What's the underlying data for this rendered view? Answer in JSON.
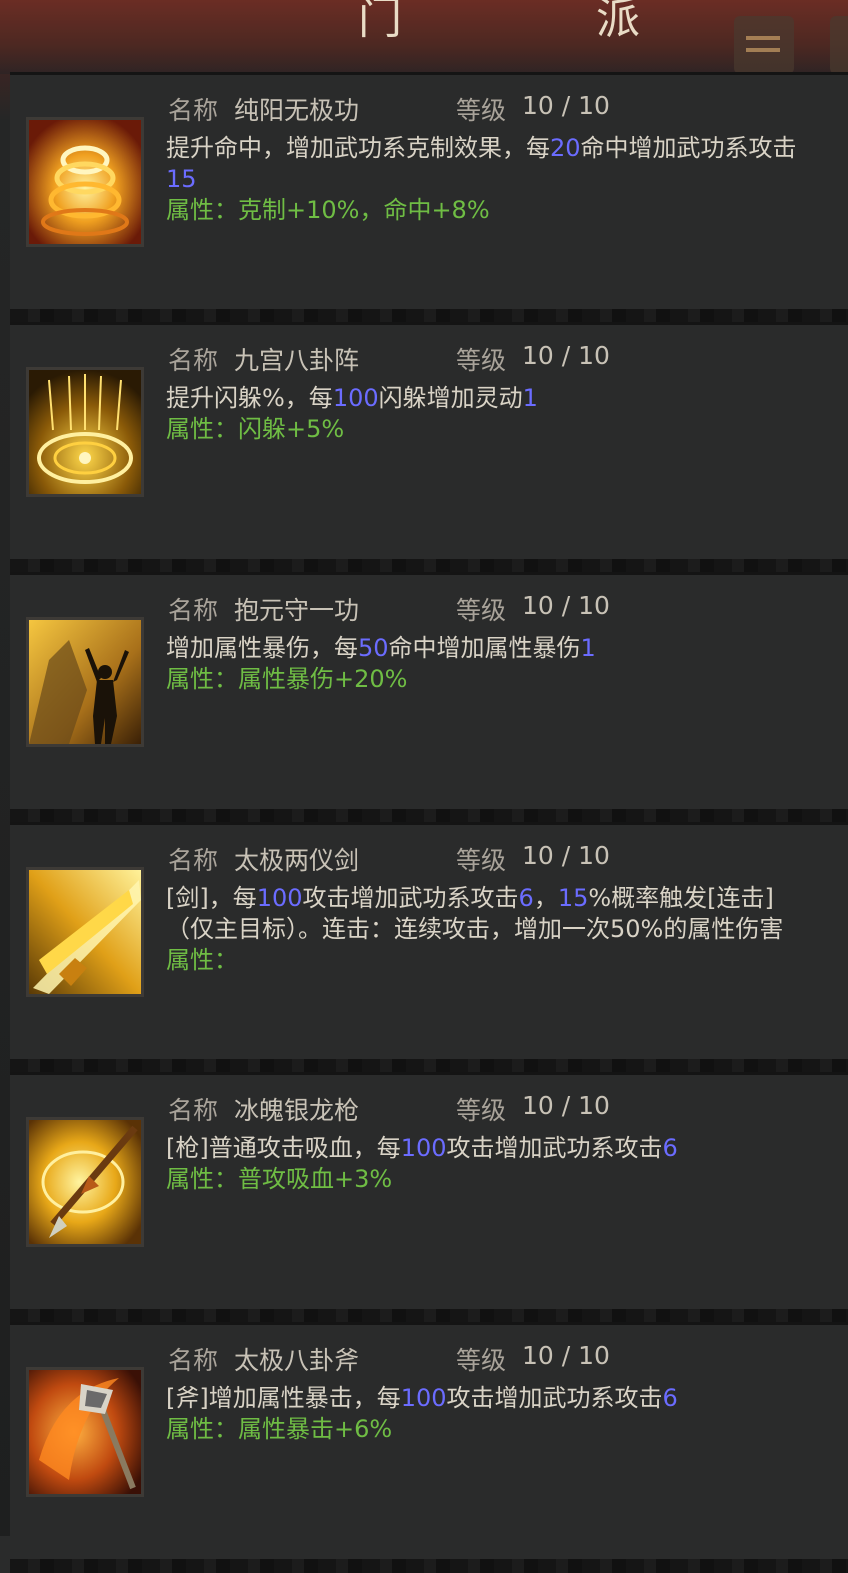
{
  "header": {
    "title": "门 派"
  },
  "labels": {
    "name": "名称",
    "level": "等级"
  },
  "skills": [
    {
      "name": "纯阳无极功",
      "level": "10 / 10",
      "icon": "golden-vortex-icon",
      "desc": [
        {
          "t": "提升命中，增加武功系克制效果，每"
        },
        {
          "t": "20",
          "h": true
        },
        {
          "t": "命中增加武功系攻击"
        },
        {
          "t": "15",
          "h": true
        }
      ],
      "attr": "属性：克制+10%，命中+8%"
    },
    {
      "name": "九宫八卦阵",
      "level": "10 / 10",
      "icon": "bagua-circle-icon",
      "desc": [
        {
          "t": "提升闪躲%，每"
        },
        {
          "t": "100",
          "h": true
        },
        {
          "t": "闪躲增加灵动"
        },
        {
          "t": "1",
          "h": true
        }
      ],
      "attr": "属性：闪躲+5%"
    },
    {
      "name": "抱元守一功",
      "level": "10 / 10",
      "icon": "meditating-figure-icon",
      "desc": [
        {
          "t": "增加属性暴伤，每"
        },
        {
          "t": "50",
          "h": true
        },
        {
          "t": "命中增加属性暴伤"
        },
        {
          "t": "1",
          "h": true
        }
      ],
      "attr": "属性：属性暴伤+20%"
    },
    {
      "name": "太极两仪剑",
      "level": "10 / 10",
      "icon": "sword-slash-icon",
      "desc": [
        {
          "t": "[剑]，每"
        },
        {
          "t": "100",
          "h": true
        },
        {
          "t": "攻击增加武功系攻击"
        },
        {
          "t": "6",
          "h": true
        },
        {
          "t": "，"
        },
        {
          "t": "15",
          "h": true
        },
        {
          "t": "%概率触发[连击]（仅主目标）。连击：连续攻击，增加一次50%的属性伤害"
        }
      ],
      "attr": "属性："
    },
    {
      "name": "冰魄银龙枪",
      "level": "10 / 10",
      "icon": "spear-thrust-icon",
      "desc": [
        {
          "t": "[枪]普通攻击吸血，每"
        },
        {
          "t": "100",
          "h": true
        },
        {
          "t": "攻击增加武功系攻击"
        },
        {
          "t": "6",
          "h": true
        }
      ],
      "attr": "属性：普攻吸血+3%"
    },
    {
      "name": "太极八卦斧",
      "level": "10 / 10",
      "icon": "axe-flame-icon",
      "desc": [
        {
          "t": "[斧]增加属性暴击，每"
        },
        {
          "t": "100",
          "h": true
        },
        {
          "t": "攻击增加武功系攻击"
        },
        {
          "t": "6",
          "h": true
        }
      ],
      "attr": "属性：属性暴击+6%"
    }
  ],
  "colors": {
    "highlight": "#6b6cff",
    "attribute": "#6fbd44",
    "text": "#d9d3c6"
  }
}
